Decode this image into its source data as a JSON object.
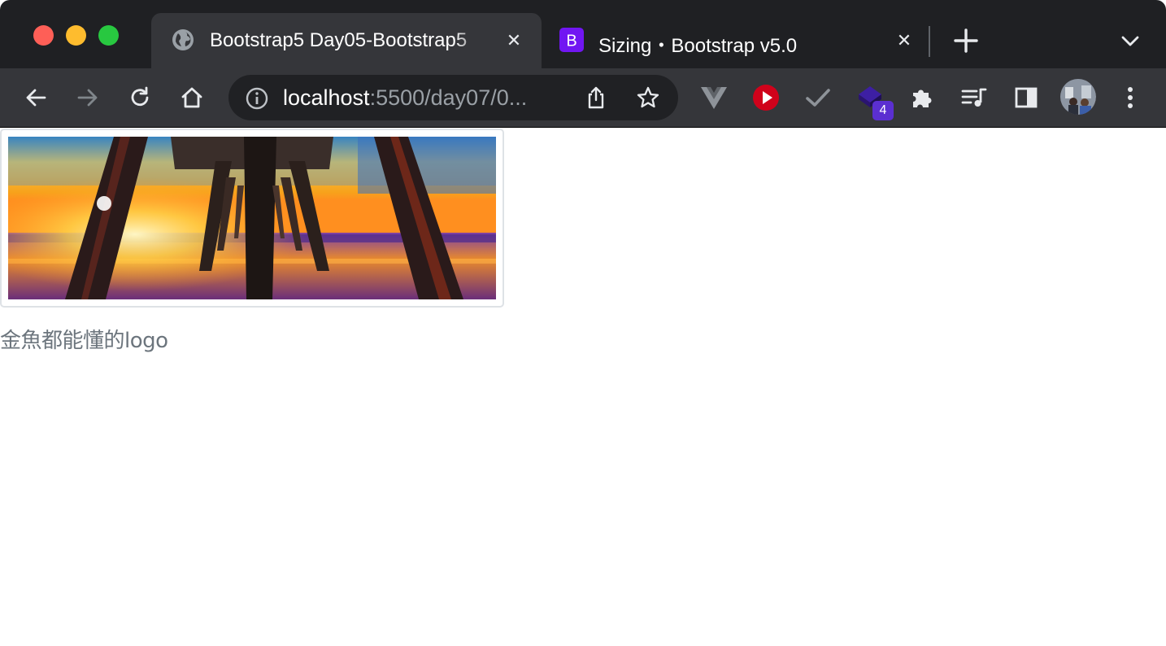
{
  "browser": {
    "tabs": [
      {
        "title": "Bootstrap5 Day05-Bootstrap5",
        "favicon": "globe-icon",
        "active": true
      },
      {
        "title": "Sizing・Bootstrap v5.0",
        "favicon": "bootstrap-icon",
        "favicon_letter": "B",
        "active": false
      }
    ],
    "address": {
      "host": "localhost",
      "rest": ":5500/day07/0..."
    },
    "extension_badge": "4",
    "colors": {
      "bootstrap_purple": "#7116f2",
      "badge": "#5b2fd1",
      "red_ext": "#d0021b"
    }
  },
  "page": {
    "image_alt": "pier at sunset",
    "caption": "金魚都能懂的logo"
  }
}
